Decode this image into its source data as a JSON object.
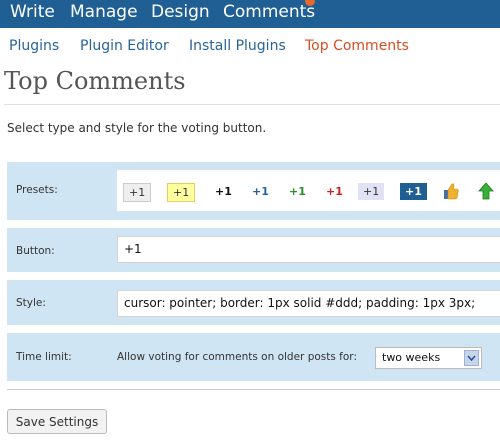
{
  "topnav": {
    "items": [
      "Write",
      "Manage",
      "Design",
      "Comments"
    ]
  },
  "subnav": {
    "items": [
      "Plugins",
      "Plugin Editor",
      "Install Plugins",
      "Top Comments"
    ]
  },
  "page": {
    "title": "Top Comments",
    "description": "Select type and style for the voting button."
  },
  "settings": {
    "presets_label": "Presets:",
    "presets": [
      "+1",
      "+1",
      "+1",
      "+1",
      "+1",
      "+1",
      "+1",
      "+1"
    ],
    "button_label": "Button:",
    "button_value": "+1",
    "style_label": "Style:",
    "style_value": "cursor: pointer; border: 1px solid #ddd; padding: 1px 3px;",
    "timelimit_label": "Time limit:",
    "timelimit_text": "Allow voting for comments on older posts for:",
    "timelimit_value": "two weeks"
  },
  "save_label": "Save Settings",
  "colors": {
    "topbar": "#1f5f93",
    "link": "#2a6496",
    "active_link": "#d54e21",
    "panel": "#d0e5f3"
  }
}
